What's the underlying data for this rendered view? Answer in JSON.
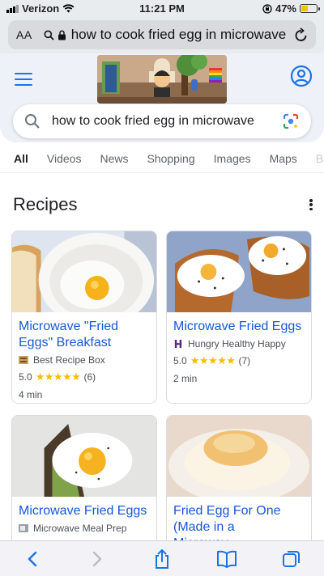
{
  "status_bar": {
    "carrier": "Verizon",
    "time": "11:21 PM",
    "battery_percent": "47%",
    "battery_level": 0.47,
    "battery_color": "#f2c300"
  },
  "address_bar": {
    "text_size_label": "AA",
    "url_text": "how to cook fried egg in microwave"
  },
  "search": {
    "query": "how to cook fried egg in microwave"
  },
  "tabs": [
    {
      "label": "All",
      "active": true
    },
    {
      "label": "Videos"
    },
    {
      "label": "News"
    },
    {
      "label": "Shopping"
    },
    {
      "label": "Images"
    },
    {
      "label": "Maps"
    },
    {
      "label": "Bo"
    }
  ],
  "recipes": {
    "heading": "Recipes",
    "cards": [
      {
        "title": "Microwave \"Fried Eggs\" Breakfast",
        "source": "Best Recipe Box",
        "rating": "5.0",
        "stars": "★★★★★",
        "reviews": "(6)",
        "time": "4 min"
      },
      {
        "title": "Microwave Fried Eggs",
        "source": "Hungry Healthy Happy",
        "rating": "5.0",
        "stars": "★★★★★",
        "reviews": "(7)",
        "time": "2 min"
      },
      {
        "title": "Microwave Fried Eggs",
        "source": "Microwave Meal Prep",
        "rating": "",
        "stars": "",
        "reviews": "",
        "time": ""
      },
      {
        "title": "Fried Egg For One (Made in a Microwav…",
        "source": "",
        "rating": "",
        "stars": "",
        "reviews": "",
        "time": ""
      }
    ]
  },
  "colors": {
    "link_blue": "#1558d6",
    "google_blue": "#1a73e8",
    "star_yellow": "#fbbc04",
    "header_bg": "#eef1f8"
  },
  "icons": {
    "address": [
      "search-icon",
      "lock-icon",
      "reload-icon"
    ],
    "header": [
      "hamburger-menu-icon",
      "account-icon"
    ],
    "toolbar": [
      "back-icon",
      "forward-icon",
      "share-icon",
      "bookmarks-icon",
      "tabs-icon"
    ]
  }
}
